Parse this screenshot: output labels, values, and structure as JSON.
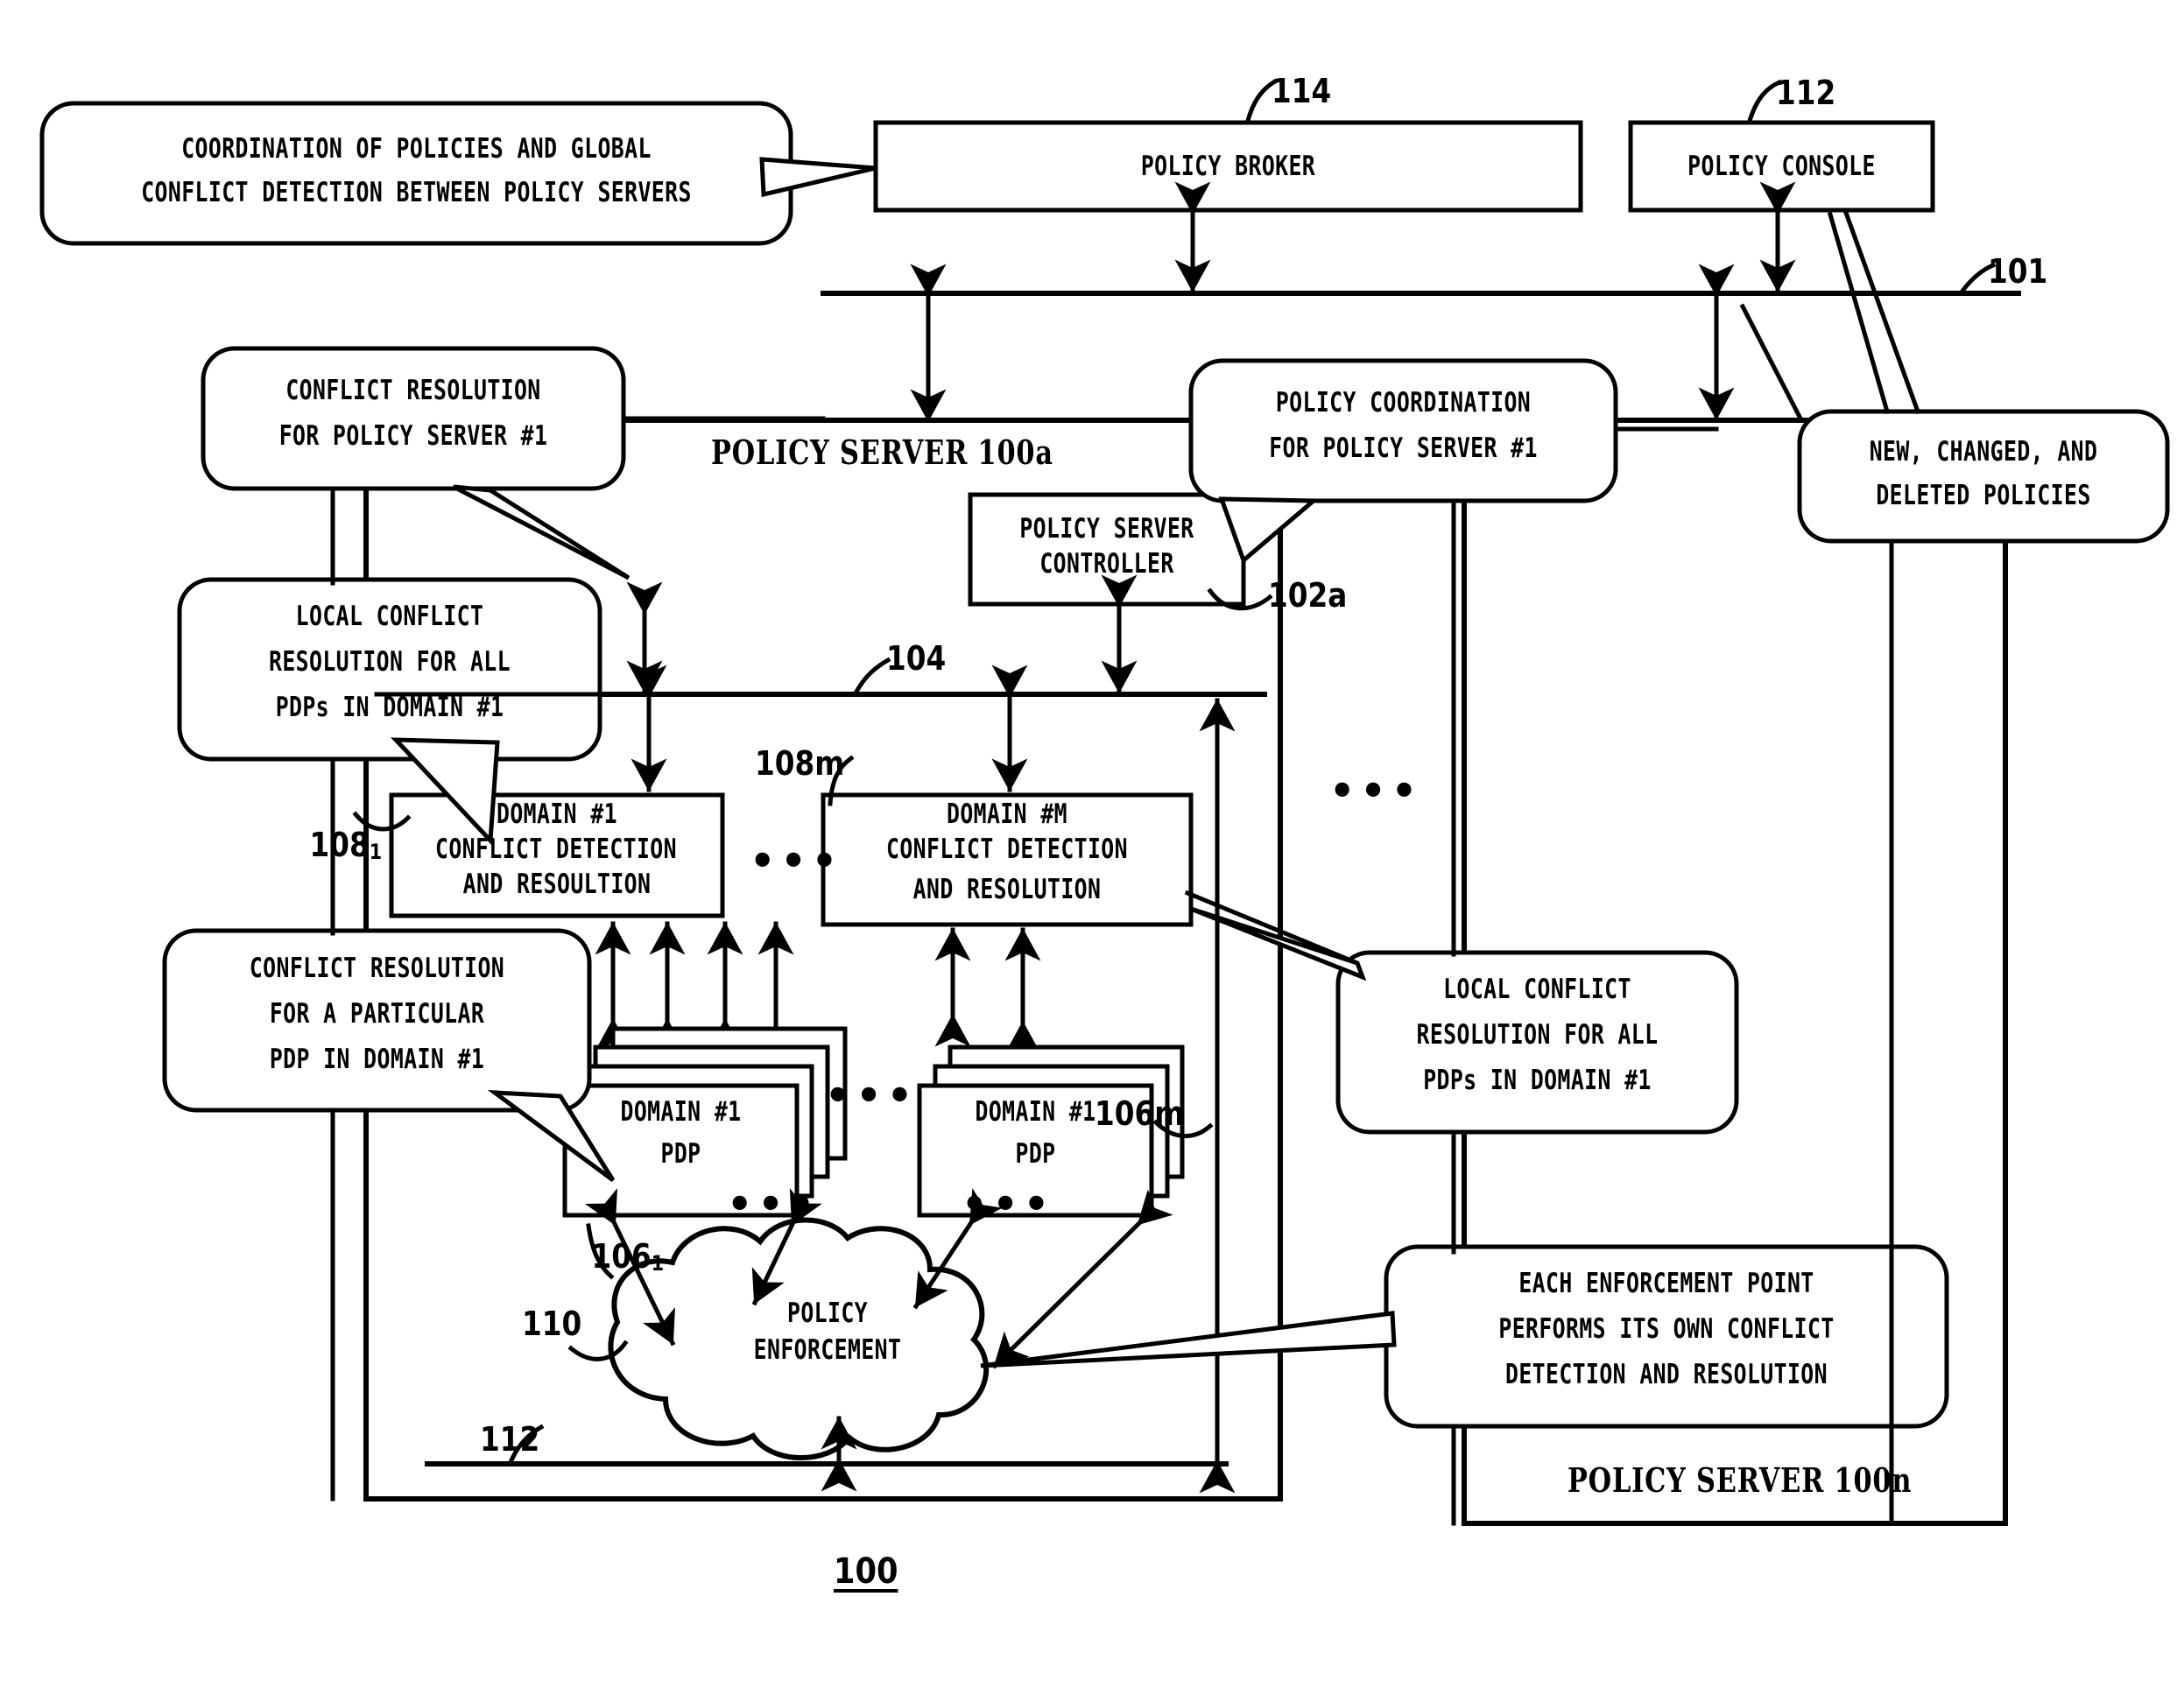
{
  "figure": {
    "number": "100",
    "type": "patent-block-diagram"
  },
  "boxes": {
    "policy_broker": "POLICY BROKER",
    "policy_console": "POLICY CONSOLE",
    "policy_server_controller_l1": "POLICY SERVER",
    "policy_server_controller_l2": "CONTROLLER",
    "domain1_cdr_l1": "DOMAIN #1",
    "domain1_cdr_l2": "CONFLICT DETECTION",
    "domain1_cdr_l3": "AND RESOULTION",
    "domainM_cdr_l1": "DOMAIN #M",
    "domainM_cdr_l2": "CONFLICT DETECTION",
    "domainM_cdr_l3": "AND RESOLUTION",
    "pdp_left_l1": "DOMAIN #1",
    "pdp_left_l2": "PDP",
    "pdp_right_l1": "DOMAIN #1",
    "pdp_right_l2": "PDP",
    "cloud_l1": "POLICY",
    "cloud_l2": "ENFORCEMENT"
  },
  "server_labels": {
    "server_a": "POLICY SERVER 100a",
    "server_n": "POLICY SERVER 100n"
  },
  "callouts": {
    "coordination": {
      "lines": [
        "COORDINATION OF POLICIES AND GLOBAL",
        "CONFLICT DETECTION BETWEEN POLICY SERVERS"
      ]
    },
    "conflict_res_server1": {
      "lines": [
        "CONFLICT RESOLUTION",
        "FOR POLICY SERVER #1"
      ]
    },
    "policy_coordination_server1": {
      "lines": [
        "POLICY COORDINATION",
        "FOR POLICY SERVER #1"
      ]
    },
    "new_changed_deleted": {
      "lines": [
        "NEW, CHANGED, AND",
        "DELETED POLICIES"
      ]
    },
    "local_conflict_left": {
      "lines": [
        "LOCAL CONFLICT",
        "RESOLUTION FOR ALL",
        "PDPs IN DOMAIN #1"
      ]
    },
    "local_conflict_right": {
      "lines": [
        "LOCAL CONFLICT",
        "RESOLUTION FOR ALL",
        "PDPs IN DOMAIN #1"
      ]
    },
    "conflict_res_pdp": {
      "lines": [
        "CONFLICT RESOLUTION",
        "FOR A PARTICULAR",
        "PDP IN DOMAIN #1"
      ]
    },
    "enforcement_point": {
      "lines": [
        "EACH ENFORCEMENT POINT",
        "PERFORMS ITS OWN CONFLICT",
        "DETECTION AND RESOLUTION"
      ]
    }
  },
  "reference_numerals": {
    "n114": "114",
    "n112_top": "112",
    "n101": "101",
    "n102a": "102a",
    "n104": "104",
    "n108_1": "108",
    "n108_1_sub": "1",
    "n108m": "108m",
    "n106_1": "106",
    "n106_1_sub": "1",
    "n106m": "106m",
    "n110": "110",
    "n112_bottom": "112",
    "n100": "100"
  },
  "ellipses": {
    "cdr_between": "•••",
    "right_top": "•••",
    "pdp_between": "•••",
    "pdp_left_below": "•••",
    "pdp_right_below": "•••"
  },
  "colors": {
    "ink": "#000000",
    "paper": "#ffffff"
  }
}
